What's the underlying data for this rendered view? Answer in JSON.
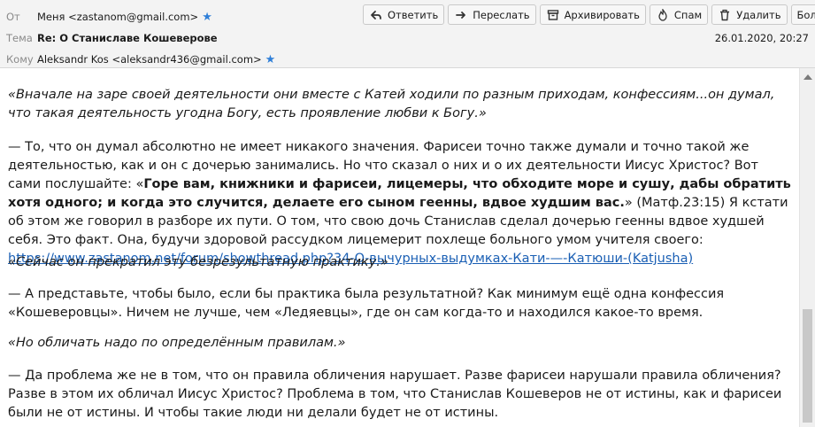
{
  "header": {
    "from_label": "От",
    "from_value": "Меня <zastanom@gmail.com>",
    "subject_label": "Тема",
    "subject_value": "Re: О Станиславе Кошеверове",
    "to_label": "Кому",
    "to_value": "Aleksandr Kos <aleksandr436@gmail.com>",
    "date": "26.01.2020, 20:27"
  },
  "toolbar": {
    "reply": "Ответить",
    "forward": "Переслать",
    "archive": "Архивировать",
    "spam": "Спам",
    "delete": "Удалить",
    "more": "Больше"
  },
  "body": {
    "q1": "«Вначале на заре своей деятельности они вместе с Катей ходили по разным приходам, конфессиям...он думал, что такая деятельность угодна Богу, есть проявление любви к Богу.»",
    "p1_a": "— То, что он думал абсолютно не имеет никакого значения. Фарисеи точно также думали и точно такой же деятельностью, как и он с дочерью занимались. Но что сказал о них и о их деятельности Иисус Христос? Вот сами послушайте: «",
    "p1_bold": "Горе вам, книжники и фарисеи, лицемеры, что обходите море и сушу, дабы обратить хотя одного; и когда это случится, делаете его сыном геенны, вдвое худшим вас.",
    "p1_b": "» (Матф.23:15) Я кстати об этом же говорил в разборе их пути. О том, что свою дочь Станислав сделал дочерью геенны вдвое худшей себя. Это факт. Она, будучи здоровой рассудком лицемерит похлеще больного умом учителя своего: ",
    "p1_link": "https://www.zastanom.net/forum/showthread.php?34-О-вычурных-выдумках-Кати-—-Катюши-(Katjusha)",
    "q2": "«Сейчас он прекратил эту безрезультатную практику.»",
    "p2": "— А представьте, чтобы было, если бы практика была результатной? Как минимум ещё одна конфессия «Кошеверовцы». Ничем не лучше, чем «Ледяевцы», где он сам когда-то и находился какое-то время.",
    "q3": "«Но обличать надо по определённым правилам.»",
    "p3": "— Да проблема же не в том, что он правила обличения нарушает. Разве фарисеи нарушали правила обличения? Разве в этом их обличал Иисус Христос? Проблема в том, что Станислав Кошеверов не от истины, как и фарисеи были не от истины. И чтобы такие люди ни делали будет не от истины."
  },
  "colors": {
    "star": "#2f7fd8",
    "link": "#1a5fb4",
    "header_bg": "#f3f3f3"
  },
  "icons": [
    "star-icon",
    "reply-icon",
    "forward-icon",
    "archive-icon",
    "spam-icon",
    "delete-icon",
    "chevron-down-icon"
  ]
}
